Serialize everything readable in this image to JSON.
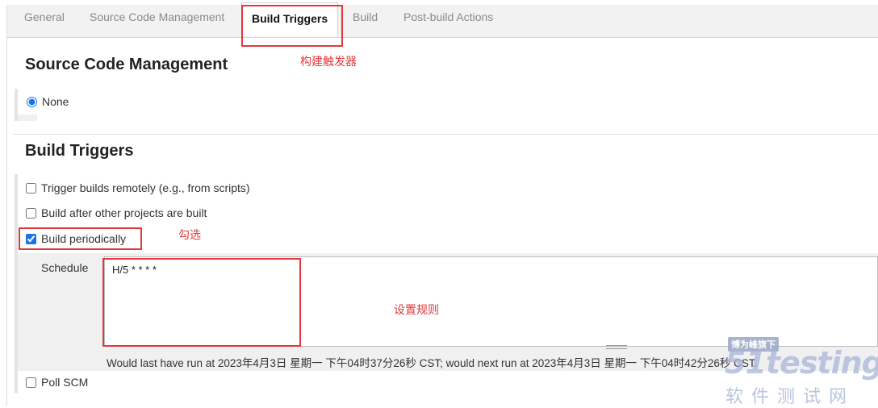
{
  "tabs": [
    {
      "label": "General"
    },
    {
      "label": "Source Code Management"
    },
    {
      "label": "Build Triggers",
      "active": true
    },
    {
      "label": "Build"
    },
    {
      "label": "Post-build Actions"
    }
  ],
  "annotations": {
    "build_triggers": "构建触发器",
    "check": "勾选",
    "set_rule": "设置规则"
  },
  "scm": {
    "title": "Source Code Management",
    "none_label": "None"
  },
  "triggers": {
    "title": "Build Triggers",
    "remote_label": "Trigger builds remotely (e.g., from scripts)",
    "after_other_label": "Build after other projects are built",
    "periodically_label": "Build periodically",
    "schedule_label": "Schedule",
    "schedule_value": "H/5 * * * *",
    "schedule_note": "Would last have run at 2023年4月3日 星期一 下午04时37分26秒 CST; would next run at 2023年4月3日 星期一 下午04时42分26秒 CST.",
    "poll_scm_label": "Poll SCM"
  },
  "watermark": {
    "badge": "博为峰旗下",
    "logo": "51testing",
    "sub": "软件测试网"
  },
  "colors": {
    "accent": "#e0393e",
    "checkbox": "#1a73e8"
  }
}
